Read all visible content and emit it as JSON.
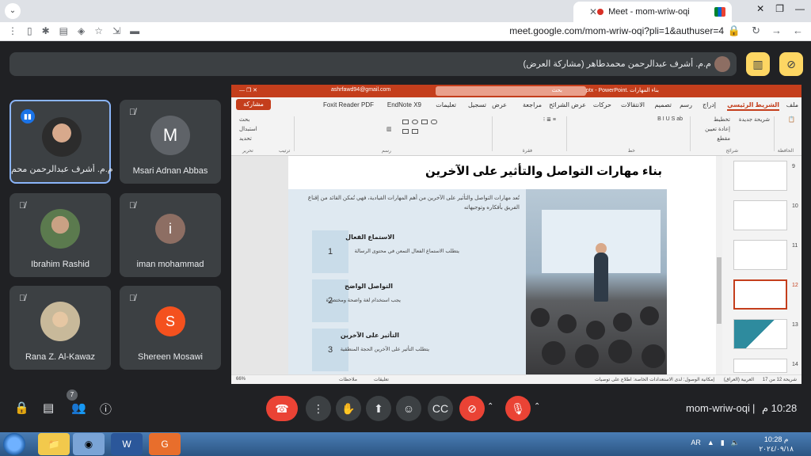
{
  "browser": {
    "tab_title": "Meet - mom-wriw-oqi",
    "url": "meet.google.com/mom-wriw-oqi?pli=1&authuser=4"
  },
  "meet": {
    "presenter_label": "م.م. أشرف عبدالرحمن محمدطاهر (مشاركة العرض)",
    "participants": [
      {
        "name": "م.م. أشرف عبدالرحمن محم...",
        "initial": "",
        "speaking": true
      },
      {
        "name": "Msari Adnan Abbas",
        "initial": "M"
      },
      {
        "name": "Ibrahim Rashid",
        "initial": ""
      },
      {
        "name": "iman mohammad",
        "initial": "i",
        "color": "#8d6e63"
      },
      {
        "name": "Rana Z. Al-Kawaz",
        "initial": ""
      },
      {
        "name": "Shereen Mosawi",
        "initial": "S",
        "color": "#f4511e"
      }
    ],
    "chat_badge": "7",
    "meeting_code": "mom-wriw-oqi",
    "separator": "|",
    "time": "10:28 م"
  },
  "powerpoint": {
    "title_bar": {
      "file": "بناء المهارات .pptx - PowerPoint",
      "search": "بحث",
      "account": "ashrfawd94@gmail.com"
    },
    "tabs": [
      "ملف",
      "الشريط الرئيسي",
      "إدراج",
      "رسم",
      "تصميم",
      "الانتقالات",
      "حركات",
      "عرض الشرائح",
      "مراجعة",
      "عرض",
      "تسجيل",
      "تعليمات",
      "EndNote X9",
      "Foxit Reader PDF"
    ],
    "share_label": "مشاركة",
    "ribbon_groups": {
      "clipboard": "الحافظة",
      "slides": "شرائح",
      "font": "خط",
      "paragraph": "فقرة",
      "drawing": "رسم",
      "editing": "تحرير",
      "arrange": "ترتيب",
      "find": "بحث",
      "replace": "استبدال",
      "select": "تحديد",
      "new_slide": "شريحة جديدة",
      "layout": "تخطيط",
      "reset": "إعادة تعيين",
      "section": "مقطع"
    },
    "slide": {
      "title": "بناء مهارات التواصل والتأثير على الآخرين",
      "intro": "تُعد مهارات التواصل والتأثير على الآخرين من أهم المهارات القيادية، فهي تُمكن القائد من إقناع الفريق بأفكاره وتوجيهاته",
      "items": [
        {
          "num": "1",
          "heading": "الاستماع الفعال",
          "desc": "يتطلب الاستماع الفعال التمعن في محتوى الرسالة"
        },
        {
          "num": "2",
          "heading": "التواصل الواضح",
          "desc": "يجب استخدام لغة واضحة ومختصرة"
        },
        {
          "num": "3",
          "heading": "التأثير على الآخرين",
          "desc": "يتطلب التأثير على الآخرين الحجة المنطقية"
        }
      ]
    },
    "thumb_numbers": [
      "9",
      "10",
      "11",
      "12",
      "13",
      "14"
    ],
    "status": {
      "slide_of": "شريحة 12 من 17",
      "lang": "العربية (العراق)",
      "accessibility": "إمكانية الوصول: لدى الاستعدادات الخاصة: اطلاع على توصيات",
      "notes": "ملاحظات",
      "comments": "تعليقات",
      "zoom": "66%"
    }
  },
  "taskbar": {
    "lang": "AR",
    "clock_time": "10:28 م",
    "clock_date": "٢٠٢٤/٠٩/١٨"
  },
  "colors": {
    "meet_bg": "#202124",
    "ppt_accent": "#c43e1c",
    "end_call": "#ea4335",
    "raise_button": "#fdd663"
  }
}
